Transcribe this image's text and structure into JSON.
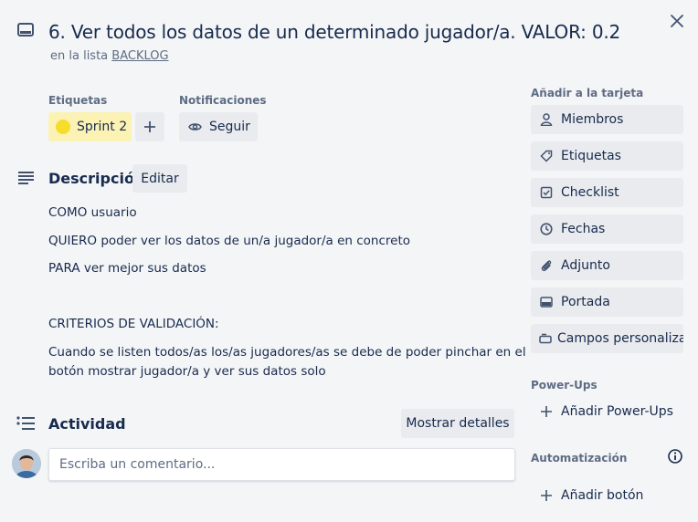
{
  "card": {
    "title": "6. Ver todos los datos de un determinado jugador/a. VALOR: 0.2",
    "list_prefix": "en la lista",
    "list_name": "BACKLOG"
  },
  "labels": {
    "heading": "Etiquetas",
    "items": [
      {
        "name": "Sprint 2",
        "color": "#f5dd29"
      }
    ],
    "add_label": "+"
  },
  "notifications": {
    "heading": "Notificaciones",
    "follow_label": "Seguir"
  },
  "description": {
    "heading": "Descripción",
    "edit_label": "Editar",
    "lines": [
      "COMO usuario",
      "QUIERO poder ver los datos de un/a jugador/a en concreto",
      "PARA ver mejor sus datos",
      "CRITERIOS DE VALIDACIÓN:",
      "Cuando se listen todos/as los/as jugadores/as se debe de poder pinchar en el",
      "botón mostrar jugador/a y ver sus datos solo"
    ]
  },
  "activity": {
    "heading": "Actividad",
    "show_details_label": "Mostrar detalles",
    "comment_placeholder": "Escriba un comentario..."
  },
  "sidebar": {
    "add_heading": "Añadir a la tarjeta",
    "add_items": [
      {
        "label": "Miembros",
        "icon": "person-icon"
      },
      {
        "label": "Etiquetas",
        "icon": "tag-icon"
      },
      {
        "label": "Checklist",
        "icon": "checklist-icon"
      },
      {
        "label": "Fechas",
        "icon": "clock-icon"
      },
      {
        "label": "Adjunto",
        "icon": "paperclip-icon"
      },
      {
        "label": "Portada",
        "icon": "cover-icon"
      },
      {
        "label": "Campos personaliza...",
        "icon": "custom-fields-icon"
      }
    ],
    "powerups_heading": "Power-Ups",
    "add_powerups_label": "Añadir Power-Ups",
    "automation_heading": "Automatización",
    "add_button_label": "Añadir botón"
  }
}
